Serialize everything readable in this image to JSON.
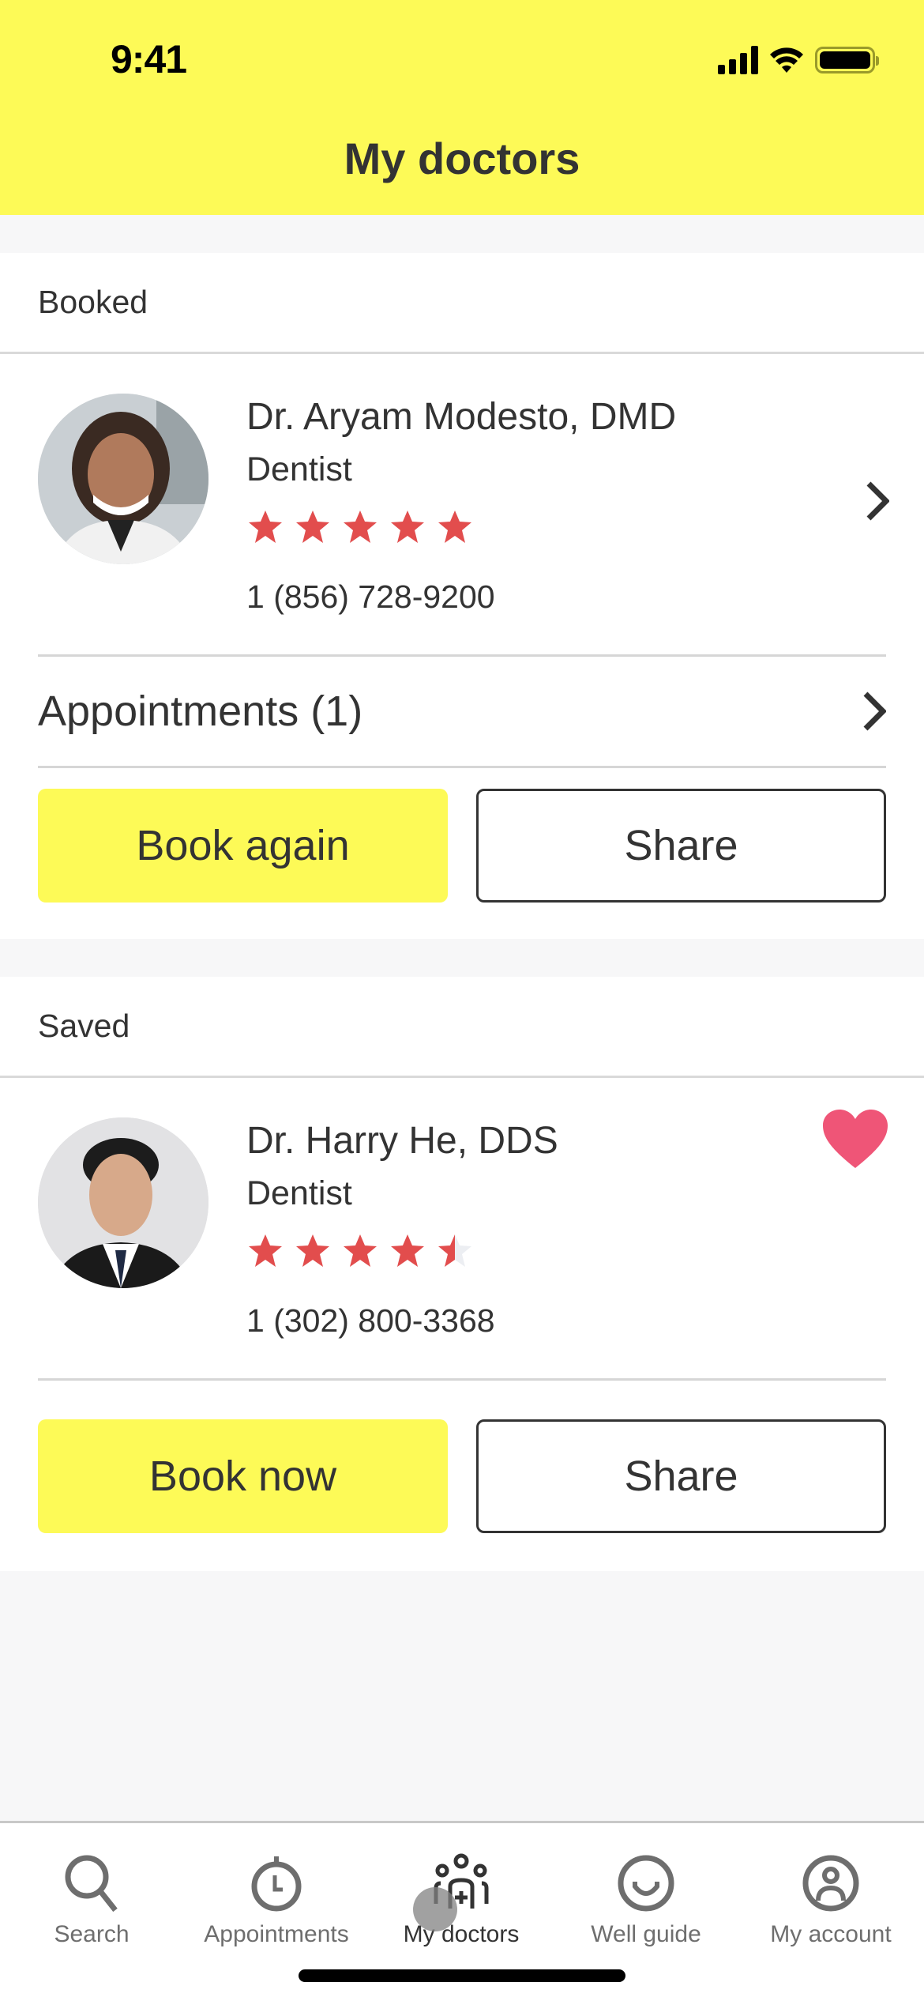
{
  "status_bar": {
    "time": "9:41"
  },
  "header": {
    "title": "My doctors"
  },
  "colors": {
    "brand_yellow": "#fdfa57",
    "star_red": "#e24d4d",
    "heart_pink": "#ef5577",
    "text_dark": "#333333"
  },
  "booked": {
    "section_label": "Booked",
    "doctor": {
      "name": "Dr. Aryam Modesto, DMD",
      "specialty": "Dentist",
      "rating": 5,
      "rating_max": 5,
      "phone": "1 (856) 728-9200"
    },
    "appointments_label": "Appointments (1)",
    "primary_button": "Book again",
    "secondary_button": "Share"
  },
  "saved": {
    "section_label": "Saved",
    "doctor": {
      "name": "Dr. Harry He, DDS",
      "specialty": "Dentist",
      "rating": 4.5,
      "rating_max": 5,
      "phone": "1 (302) 800-3368",
      "favorited": true
    },
    "primary_button": "Book now",
    "secondary_button": "Share"
  },
  "tabbar": {
    "items": [
      {
        "label": "Search",
        "icon": "search-icon"
      },
      {
        "label": "Appointments",
        "icon": "stopwatch-icon"
      },
      {
        "label": "My doctors",
        "icon": "doctors-group-icon",
        "active": true
      },
      {
        "label": "Well guide",
        "icon": "smile-icon"
      },
      {
        "label": "My account",
        "icon": "account-icon"
      }
    ]
  }
}
